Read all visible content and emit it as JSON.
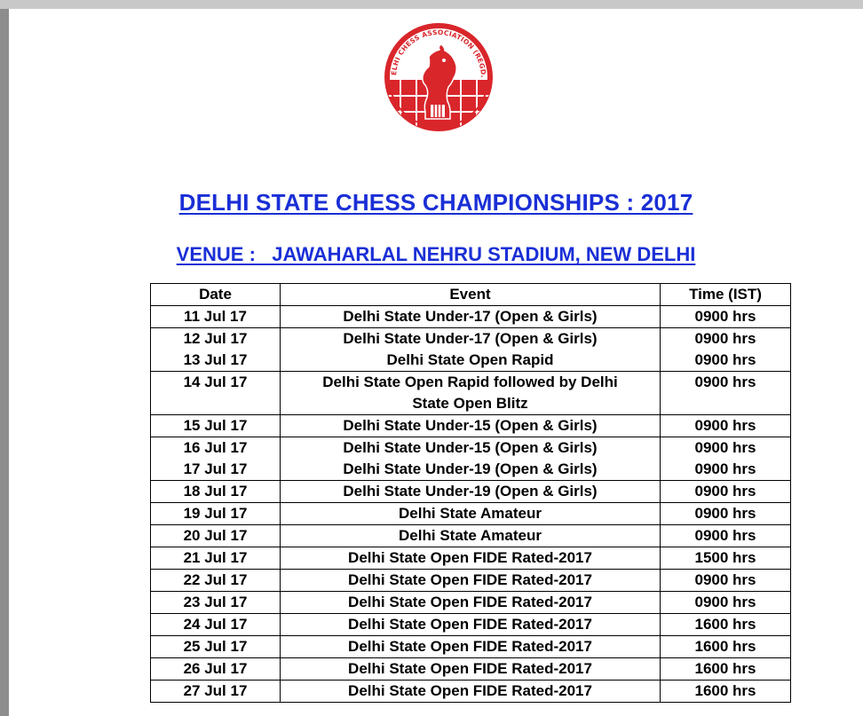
{
  "logo": {
    "ring_text": "DELHI CHESS ASSOCIATION (REGD.)",
    "colors": {
      "red": "#d9262b",
      "white": "#ffffff"
    }
  },
  "heading": {
    "title": "DELHI STATE CHESS CHAMPIONSHIPS : 2017",
    "venue": "VENUE :   JAWAHARLAL NEHRU STADIUM, NEW DELHI"
  },
  "colors": {
    "heading": "#1a2fd6"
  },
  "table": {
    "headers": {
      "date": "Date",
      "event": "Event",
      "time": "Time (IST)"
    },
    "rows": [
      {
        "date": "11 Jul 17",
        "event": "Delhi State Under-17 (Open & Girls)",
        "time": "0900 hrs"
      },
      {
        "date": "12 Jul 17",
        "event": "Delhi State Under-17 (Open & Girls)",
        "time": "0900 hrs"
      },
      {
        "date": "13 Jul 17",
        "event": "Delhi State Open Rapid",
        "time": "0900 hrs"
      },
      {
        "date": "14 Jul 17",
        "event": "Delhi State Open Rapid followed by Delhi",
        "event_line2": "State Open Blitz",
        "time": "0900 hrs"
      },
      {
        "date": "15 Jul 17",
        "event": "Delhi State Under-15 (Open & Girls)",
        "time": "0900 hrs"
      },
      {
        "date": "16 Jul 17",
        "event": "Delhi State Under-15 (Open & Girls)",
        "time": "0900 hrs"
      },
      {
        "date": "17 Jul 17",
        "event": "Delhi State Under-19 (Open & Girls)",
        "time": "0900 hrs"
      },
      {
        "date": "18 Jul 17",
        "event": "Delhi State Under-19 (Open & Girls)",
        "time": "0900 hrs"
      },
      {
        "date": "19 Jul 17",
        "event": "Delhi State Amateur",
        "time": "0900 hrs"
      },
      {
        "date": "20 Jul 17",
        "event": "Delhi State Amateur",
        "time": "0900 hrs"
      },
      {
        "date": "21 Jul 17",
        "event": "Delhi State Open FIDE Rated-2017",
        "time": "1500 hrs"
      },
      {
        "date": "22 Jul 17",
        "event": "Delhi State Open FIDE Rated-2017",
        "time": "0900 hrs"
      },
      {
        "date": "23 Jul 17",
        "event": "Delhi State Open FIDE Rated-2017",
        "time": "0900 hrs"
      },
      {
        "date": "24 Jul 17",
        "event": "Delhi State Open FIDE Rated-2017",
        "time": "1600 hrs"
      },
      {
        "date": "25 Jul 17",
        "event": "Delhi State Open FIDE Rated-2017",
        "time": "1600 hrs"
      },
      {
        "date": "26 Jul 17",
        "event": "Delhi State Open FIDE Rated-2017",
        "time": "1600 hrs"
      },
      {
        "date": "27 Jul 17",
        "event": "Delhi State Open FIDE Rated-2017",
        "time": "1600 hrs"
      }
    ]
  }
}
